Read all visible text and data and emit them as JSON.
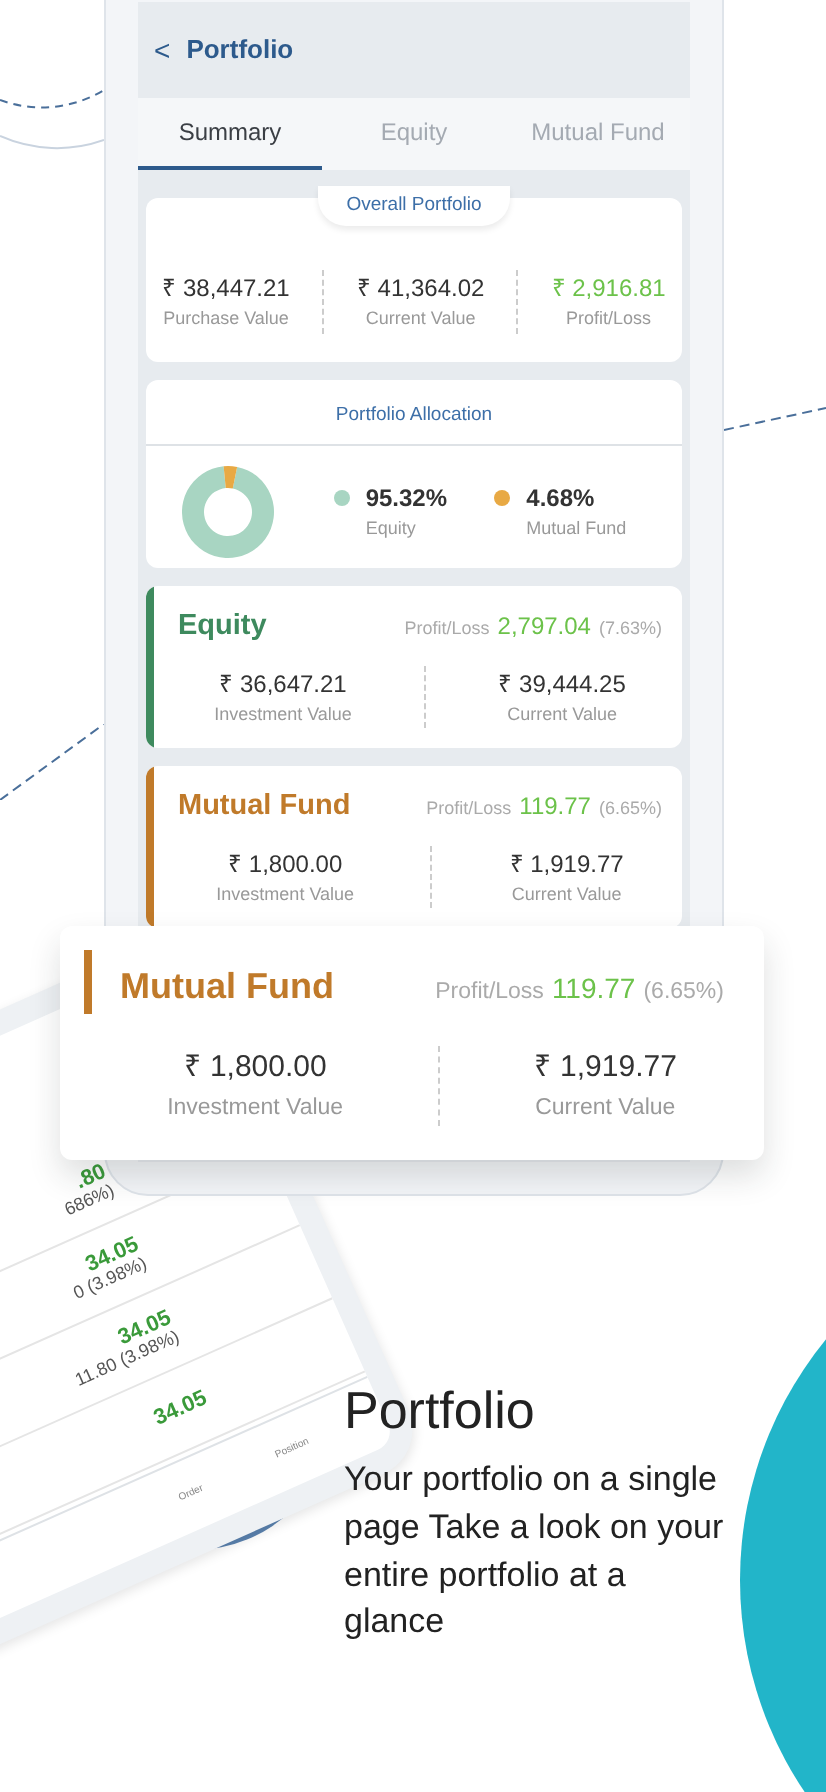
{
  "header": {
    "back": "<",
    "title": "Portfolio"
  },
  "tabs": [
    {
      "label": "Summary",
      "selected": true
    },
    {
      "label": "Equity",
      "selected": false
    },
    {
      "label": "Mutual Fund",
      "selected": false
    }
  ],
  "overall": {
    "title": "Overall Portfolio",
    "stats": [
      {
        "value": "₹ 38,447.21",
        "label": "Purchase Value",
        "kind": "plain"
      },
      {
        "value": "₹ 41,364.02",
        "label": "Current Value",
        "kind": "plain"
      },
      {
        "value": "₹ 2,916.81",
        "label": "Profit/Loss",
        "kind": "gain"
      }
    ]
  },
  "allocation": {
    "title": "Portfolio Allocation",
    "items": [
      {
        "value": "95.32%",
        "label": "Equity",
        "color": "#a8d5c2"
      },
      {
        "value": "4.68%",
        "label": "Mutual Fund",
        "color": "#e8a944"
      }
    ]
  },
  "holdings": [
    {
      "name": "Equity",
      "color": "#3e8a5e",
      "pl_label": "Profit/Loss",
      "pl_value": "2,797.04",
      "pl_pct": "(7.63%)",
      "stats": [
        {
          "value": "₹ 36,647.21",
          "label": "Investment Value"
        },
        {
          "value": "₹  39,444.25",
          "label": "Current Value"
        }
      ]
    },
    {
      "name": "Mutual Fund",
      "color": "#c07a2a",
      "pl_label": "Profit/Loss",
      "pl_value": "119.77",
      "pl_pct": "(6.65%)",
      "stats": [
        {
          "value": "₹ 1,800.00",
          "label": "Investment Value"
        },
        {
          "value": "₹ 1,919.77",
          "label": "Current Value"
        }
      ]
    }
  ],
  "highlight": {
    "name": "Mutual Fund",
    "color": "#c07a2a",
    "pl_label": "Profit/Loss",
    "pl_value": "119.77",
    "pl_pct": "(6.65%)",
    "stats": [
      {
        "value": "₹ 1,800.00",
        "label": "Investment Value"
      },
      {
        "value": "₹ 1,919.77",
        "label": "Current Value"
      }
    ]
  },
  "tilted_phone": {
    "rows": [
      {
        "price": ".80",
        "change": "686%)"
      },
      {
        "price": "34.05",
        "change": "0 (3.98%)"
      },
      {
        "price": "34.05",
        "change": "11.80 (3.98%)"
      },
      {
        "price": "34.05"
      }
    ],
    "tabs": [
      {
        "label": "Order"
      },
      {
        "label": "Position"
      }
    ]
  },
  "promo": {
    "title": "Portfolio",
    "text": "Your portfolio on a single page Take a look on your entire portfolio at a glance"
  }
}
